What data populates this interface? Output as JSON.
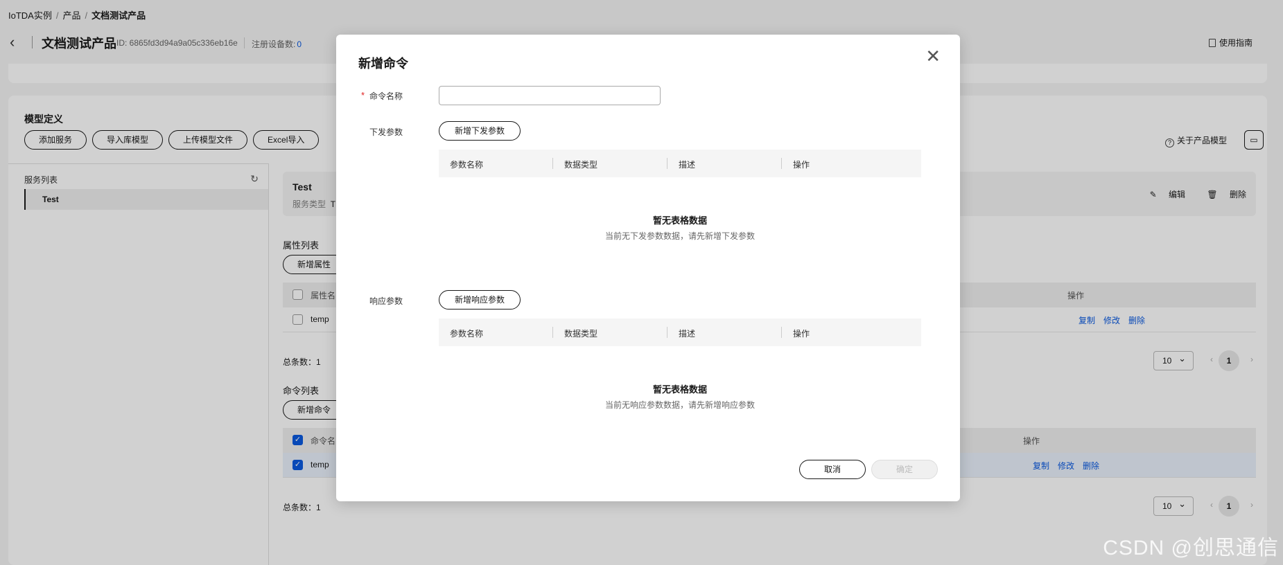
{
  "breadcrumb": {
    "item1": "IoTDA实例",
    "item2": "产品",
    "current": "文档测试产品",
    "sep": "/"
  },
  "header": {
    "title": "文档测试产品",
    "id_text": "ID: 6865fd3d94a9a05c336eb16e",
    "reg_label": "注册设备数:",
    "reg_count": "0",
    "guide": "使用指南"
  },
  "model": {
    "title": "模型定义",
    "buttons": [
      "添加服务",
      "导入库模型",
      "上传模型文件",
      "Excel导入"
    ],
    "about": "关于产品模型",
    "service_list_label": "服务列表",
    "service_item": "Test"
  },
  "service_detail": {
    "name": "Test",
    "type_label": "服务类型",
    "type_value": "T",
    "edit": "编辑",
    "delete": "删除"
  },
  "properties": {
    "label": "属性列表",
    "add_button": "新增属性",
    "col_name": "属性名",
    "col_ops": "操作",
    "row_name": "temp",
    "links": [
      "复制",
      "修改",
      "删除"
    ],
    "total": "总条数：1",
    "page_size": "10",
    "page": "1"
  },
  "commands": {
    "label": "命令列表",
    "add_button": "新增命令",
    "col_name": "命令名",
    "col_ops": "操作",
    "row_name": "temp",
    "links": [
      "复制",
      "修改",
      "删除"
    ],
    "total": "总条数：1",
    "page_size": "10",
    "page": "1"
  },
  "dialog": {
    "title": "新增命令",
    "name_label": "命令名称",
    "name_value": "",
    "required_mark": "*",
    "down_label": "下发参数",
    "down_add": "新增下发参数",
    "resp_label": "响应参数",
    "resp_add": "新增响应参数",
    "columns": [
      "参数名称",
      "数据类型",
      "描述",
      "操作"
    ],
    "empty_title": "暂无表格数据",
    "down_empty_sub": "当前无下发参数数据，请先新增下发参数",
    "resp_empty_sub": "当前无响应参数数据，请先新增响应参数",
    "cancel": "取消",
    "ok": "确定"
  },
  "watermark": "CSDN @创思通信",
  "colors": {
    "link": "#0a59e0",
    "required": "#e02020",
    "checkbox": "#0a59e0"
  },
  "icons": [
    "back-arrow-icon",
    "book-icon",
    "help-circle-icon",
    "folder-icon",
    "refresh-icon",
    "edit-icon",
    "trash-icon",
    "close-icon",
    "chevron-down-icon",
    "chevron-left-icon",
    "chevron-right-icon",
    "check-icon"
  ]
}
